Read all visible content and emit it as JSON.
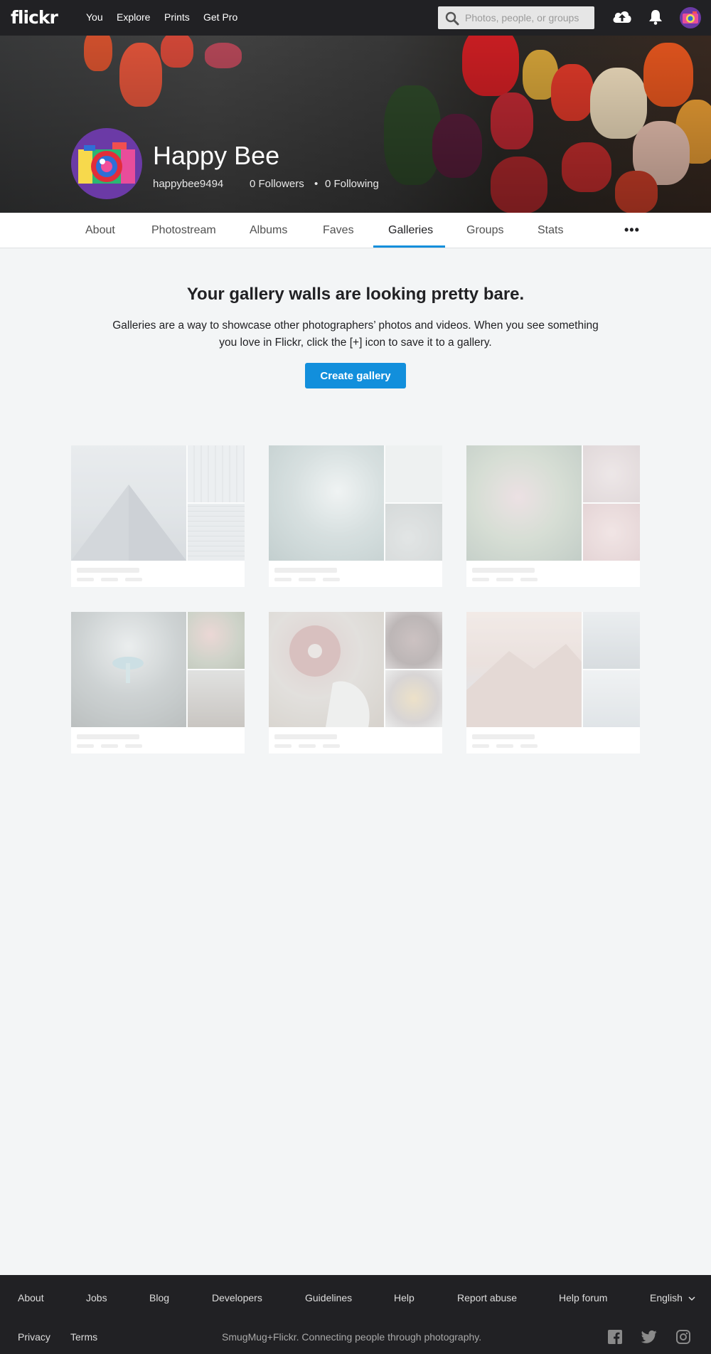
{
  "topbar": {
    "logo": "flickr",
    "nav": [
      "You",
      "Explore",
      "Prints",
      "Get Pro"
    ],
    "search_placeholder": "Photos, people, or groups",
    "icons": [
      "search-icon",
      "upload-cloud-icon",
      "notifications-bell-icon",
      "user-avatar"
    ]
  },
  "profile": {
    "name": "Happy Bee",
    "username": "happybee9494",
    "followers": "0 Followers",
    "separator": "•",
    "following": "0 Following"
  },
  "tabs": {
    "items": [
      "About",
      "Photostream",
      "Albums",
      "Faves",
      "Galleries",
      "Groups",
      "Stats"
    ],
    "active": "Galleries",
    "more": "•••"
  },
  "empty_state": {
    "title": "Your gallery walls are looking pretty bare.",
    "description": "Galleries are a way to showcase other photographers’ photos and videos. When you see something you love in Flickr, click the [+] icon to save it to a gallery.",
    "button": "Create gallery"
  },
  "placeholder_galleries": [
    "glass-building",
    "ocean-waves",
    "pink-flowers",
    "mushrooms",
    "donuts",
    "misty-mountains"
  ],
  "footer": {
    "links": [
      "About",
      "Jobs",
      "Blog",
      "Developers",
      "Guidelines",
      "Help",
      "Report abuse",
      "Help forum"
    ],
    "language": "English",
    "legal": [
      "Privacy",
      "Terms"
    ],
    "tagline": "SmugMug+Flickr. Connecting people through photography.",
    "social": [
      "facebook-icon",
      "twitter-icon",
      "instagram-icon"
    ]
  },
  "colors": {
    "accent": "#128fdc",
    "topbar": "#212124",
    "page_bg": "#f3f5f6"
  }
}
